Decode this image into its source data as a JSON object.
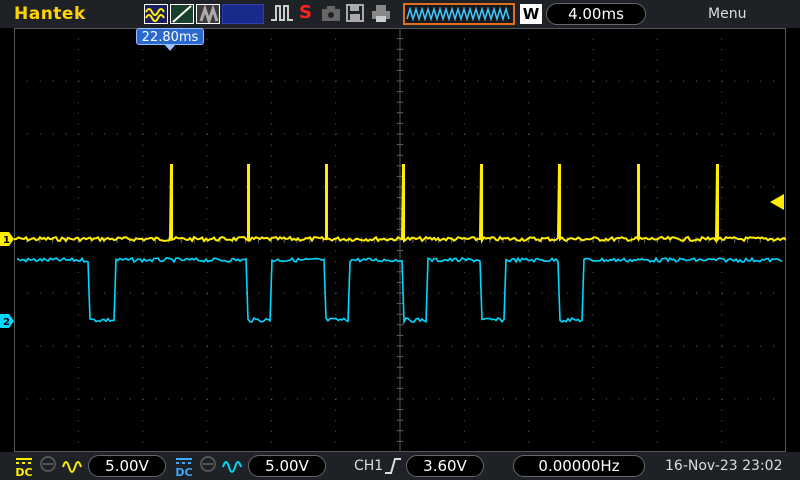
{
  "brand": "Hantek",
  "toolbar": {
    "icons": [
      "channel-wave-icon",
      "slope-icon",
      "roll-icon",
      "waveform-icon",
      "stop-icon",
      "screenshot-icon",
      "save-icon",
      "print-icon"
    ],
    "stop_label": "S",
    "acq_mode": "W",
    "timebase": "4.00ms",
    "menu": "Menu"
  },
  "trigger_position": "22.80ms",
  "channels": {
    "ch1": {
      "marker": "1",
      "color": "#ffee00",
      "coupling": "DC",
      "volts_div": "5.00V"
    },
    "ch2": {
      "marker": "2",
      "color": "#00d8ff",
      "coupling": "DC",
      "volts_div": "5.00V"
    }
  },
  "trigger": {
    "source": "CH1",
    "slope": "rising",
    "level": "3.60V",
    "frequency": "0.00000Hz"
  },
  "datetime": "16-Nov-23 23:02",
  "colors": {
    "accent_orange": "#e07020",
    "grid": "#555555"
  }
}
